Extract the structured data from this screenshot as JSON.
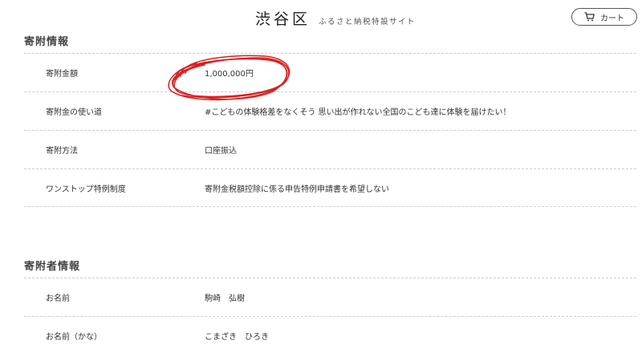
{
  "header": {
    "logo": "渋谷区",
    "subtitle": "ふるさと納税特設サイト",
    "cart_label": "カート",
    "cart_icon": "cart-icon"
  },
  "donation": {
    "title": "寄附情報",
    "rows": [
      {
        "label": "寄附金額",
        "value": "1,000,000円"
      },
      {
        "label": "寄附金の使い道",
        "value": "#こどもの体験格差をなくそう 思い出が作れない全国のこども達に体験を届けたい！"
      },
      {
        "label": "寄附方法",
        "value": "口座振込"
      },
      {
        "label": "ワンストップ特例制度",
        "value": "寄附金税額控除に係る申告特例申請書を希望しない"
      }
    ]
  },
  "donor": {
    "title": "寄附者情報",
    "rows": [
      {
        "label": "お名前",
        "value": "駒崎　弘樹"
      },
      {
        "label": "お名前（かな）",
        "value": "こまざき　ひろき"
      }
    ]
  },
  "annotation": {
    "color": "#d92020"
  }
}
